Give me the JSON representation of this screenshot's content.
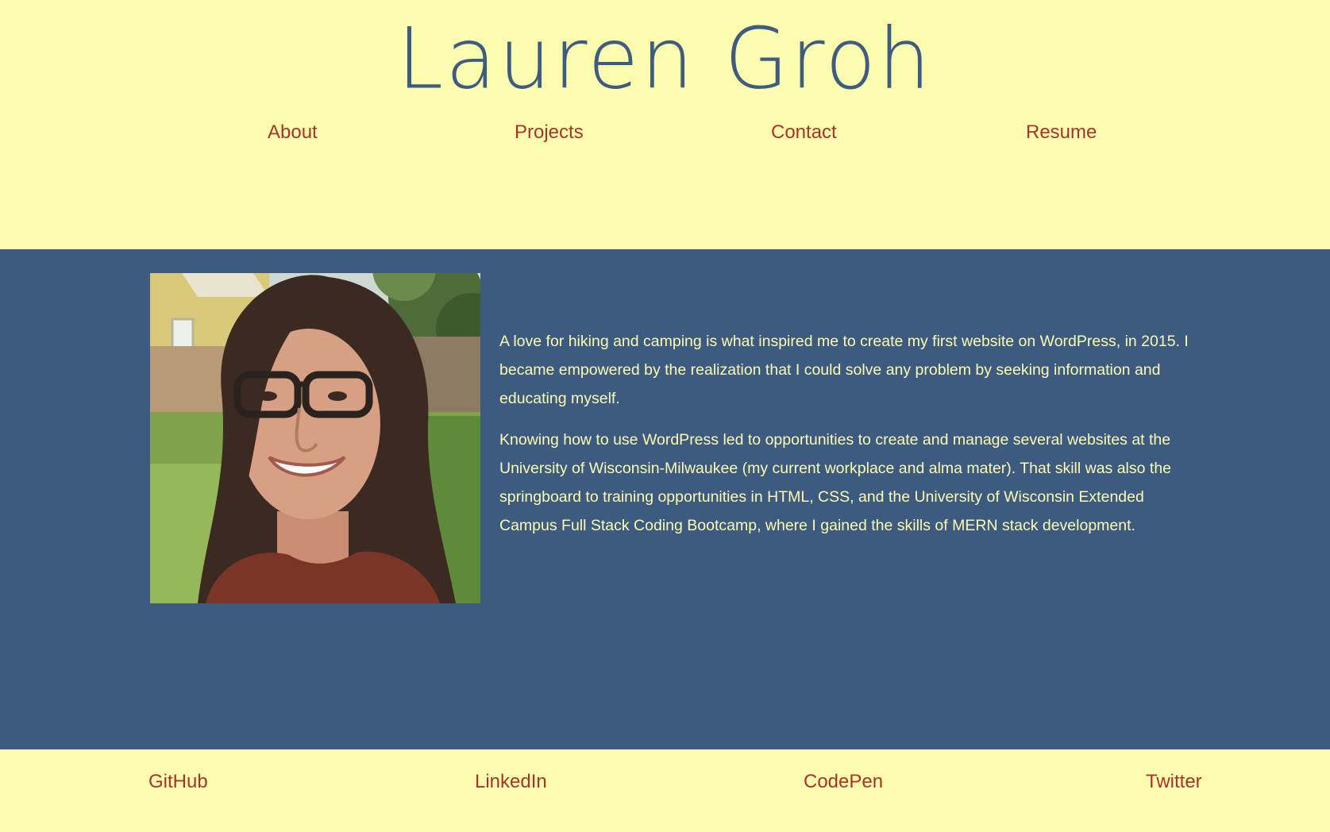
{
  "header": {
    "title": "Lauren Groh",
    "nav": [
      {
        "label": "About"
      },
      {
        "label": "Projects"
      },
      {
        "label": "Contact"
      },
      {
        "label": "Resume"
      }
    ]
  },
  "about": {
    "portrait_icon": "person-photo",
    "paragraphs": [
      "A love for hiking and camping is what inspired me to create my first website on WordPress, in 2015. I became empowered by the realization that I could solve any problem by seeking information and educating myself.",
      "Knowing how to use WordPress led to opportunities to create and manage several websites at the University of Wisconsin-Milwaukee (my current workplace and alma mater). That skill was also the springboard to training opportunities in HTML, CSS, and the University of Wisconsin Extended Campus Full Stack Coding Bootcamp, where I gained the skills of MERN stack development."
    ]
  },
  "footer": {
    "links": [
      {
        "label": "GitHub"
      },
      {
        "label": "LinkedIn"
      },
      {
        "label": "CodePen"
      },
      {
        "label": "Twitter"
      }
    ]
  },
  "colors": {
    "background_light": "#fcfcae",
    "background_dark": "#3d5b80",
    "title": "#3e5c80",
    "link": "#a4352b",
    "body_text": "#fcfcae"
  }
}
